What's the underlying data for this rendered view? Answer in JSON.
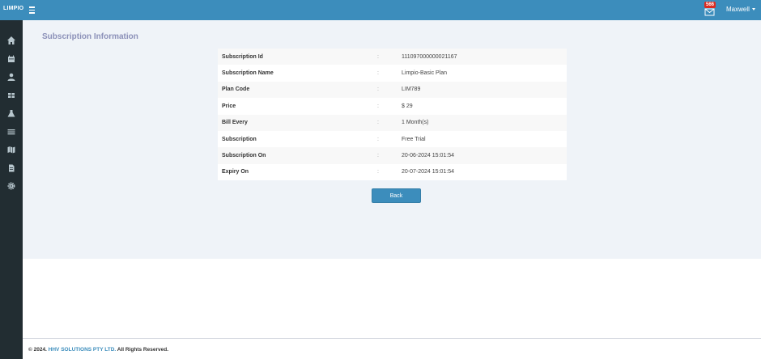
{
  "header": {
    "brand": "LIMPIO",
    "notification_count": "566",
    "user_name": "Maxwell"
  },
  "sidebar": {
    "items": [
      {
        "icon": "home-icon"
      },
      {
        "icon": "calendar-icon"
      },
      {
        "icon": "user-icon"
      },
      {
        "icon": "dashboard-grid-icon"
      },
      {
        "icon": "flask-icon"
      },
      {
        "icon": "list-icon"
      },
      {
        "icon": "map-icon"
      },
      {
        "icon": "file-icon"
      },
      {
        "icon": "settings-icon"
      }
    ]
  },
  "main": {
    "title": "Subscription Information",
    "separator": ":",
    "rows": [
      {
        "label": "Subscription Id",
        "value": "111097000000021167"
      },
      {
        "label": "Subscription Name",
        "value": "Limpio-Basic Plan"
      },
      {
        "label": "Plan Code",
        "value": "LIM789"
      },
      {
        "label": "Price",
        "value": "$ 29"
      },
      {
        "label": "Bill Every",
        "value": "1 Month(s)"
      },
      {
        "label": "Subscription",
        "value": "Free Trial"
      },
      {
        "label": "Subscription On",
        "value": "20-06-2024 15:01:54"
      },
      {
        "label": "Expiry On",
        "value": "20-07-2024 15:01:54"
      }
    ],
    "back_label": "Back"
  },
  "footer": {
    "prefix": "© 2024. ",
    "company": "HHV SOLUTIONS PTY LTD.",
    "suffix": " All Rights Reserved."
  },
  "colors": {
    "topbar": "#3c8dbc",
    "sidebar": "#222d32",
    "content_bg": "#eff3f8",
    "title": "#8b90b8",
    "badge": "#dd2c22"
  }
}
